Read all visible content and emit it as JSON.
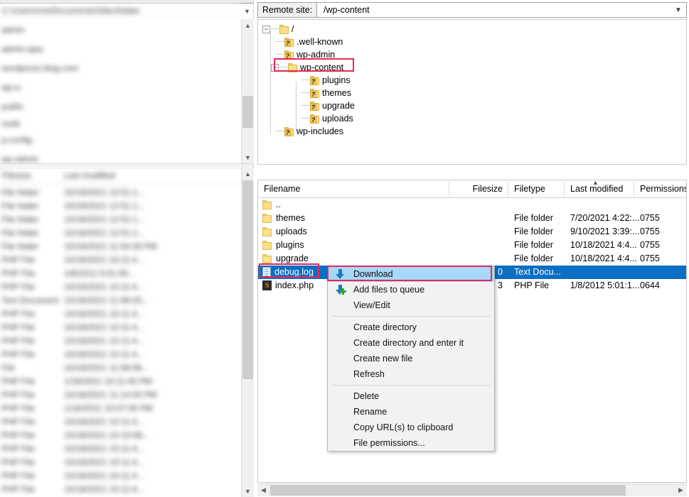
{
  "app": {
    "name": "FileZilla FTP client"
  },
  "local_pane": {
    "path_placeholder": "",
    "blurred": true,
    "tree_rows": [
      "",
      "",
      "",
      "",
      "",
      "",
      "",
      "",
      ""
    ],
    "list_headers": [
      "Filesize",
      "Last modified"
    ],
    "list_rows": [
      [
        "File folder",
        "10/18/2021 12:51:1..."
      ],
      [
        "File folder",
        "10/18/2021 12:51:1..."
      ],
      [
        "File folder",
        "10/18/2021 12:51:1..."
      ],
      [
        "File folder",
        "10/18/2021 12:51:1..."
      ],
      [
        "File folder",
        "10/18/2021 11:54:28 PM"
      ],
      [
        "PHP File",
        "10/18/2021 10:11:4..."
      ],
      [
        "PHP File",
        "1/8/2012 5:01:00..."
      ],
      [
        "PHP File",
        "10/18/2021 10:11:4..."
      ],
      [
        "Text Document",
        "10/18/2021 11:08:20..."
      ],
      [
        "PHP File",
        "10/18/2021 10:11:4..."
      ],
      [
        "PHP File",
        "10/18/2021 10:11:4..."
      ],
      [
        "PHP File",
        "10/18/2021 10:11:4..."
      ],
      [
        "PHP File",
        "10/18/2021 10:11:4..."
      ],
      [
        "File",
        "10/18/2021 11:08:08..."
      ],
      [
        "PHP File",
        "1/18/2021 10:11:40 PM"
      ],
      [
        "PHP File",
        "10/18/2021 11:14:04 PM"
      ],
      [
        "PHP File",
        "1/18/2021 10:07:00 PM"
      ],
      [
        "PHP File",
        "10/18/2021 10:11:4..."
      ],
      [
        "PHP File",
        "10/18/2021 10:10:08..."
      ],
      [
        "PHP File",
        "10/18/2021 10:11:4..."
      ],
      [
        "PHP File",
        "10/18/2021 10:11:4..."
      ],
      [
        "PHP File",
        "10/18/2021 10:11:4..."
      ],
      [
        "PHP File",
        "10/18/2021 10:11:4..."
      ]
    ]
  },
  "remote": {
    "label": "Remote site:",
    "path": "/wp-content",
    "dropdown_icon": "chevron-down-icon",
    "tree": [
      {
        "label": "/",
        "depth": 0,
        "icon": "folder-icon",
        "expander": "minus"
      },
      {
        "label": ".well-known",
        "depth": 1,
        "icon": "folder-unknown-icon",
        "expander": "none"
      },
      {
        "label": "wp-admin",
        "depth": 1,
        "icon": "folder-unknown-icon",
        "expander": "none"
      },
      {
        "label": "wp-content",
        "depth": 1,
        "icon": "folder-icon",
        "expander": "minus",
        "highlighted": true
      },
      {
        "label": "plugins",
        "depth": 2,
        "icon": "folder-unknown-icon",
        "expander": "none"
      },
      {
        "label": "themes",
        "depth": 2,
        "icon": "folder-unknown-icon",
        "expander": "none"
      },
      {
        "label": "upgrade",
        "depth": 2,
        "icon": "folder-unknown-icon",
        "expander": "none"
      },
      {
        "label": "uploads",
        "depth": 2,
        "icon": "folder-unknown-icon",
        "expander": "none"
      },
      {
        "label": "wp-includes",
        "depth": 1,
        "icon": "folder-unknown-icon",
        "expander": "none"
      }
    ],
    "columns": {
      "filename": "Filename",
      "filesize": "Filesize",
      "filetype": "Filetype",
      "last_modified": "Last modified",
      "permissions": "Permissions",
      "sorted_column": "Last modified",
      "sort_direction": "ascending"
    },
    "files": [
      {
        "name": "..",
        "icon": "folder-icon",
        "size": "",
        "type": "",
        "modified": "",
        "perms": "",
        "selected": false
      },
      {
        "name": "themes",
        "icon": "folder-icon",
        "size": "",
        "type": "File folder",
        "modified": "7/20/2021 4:22:...",
        "perms": "0755",
        "selected": false
      },
      {
        "name": "uploads",
        "icon": "folder-icon",
        "size": "",
        "type": "File folder",
        "modified": "9/10/2021 3:39:...",
        "perms": "0755",
        "selected": false
      },
      {
        "name": "plugins",
        "icon": "folder-icon",
        "size": "",
        "type": "File folder",
        "modified": "10/18/2021 4:4...",
        "perms": "0755",
        "selected": false
      },
      {
        "name": "upgrade",
        "icon": "folder-icon",
        "size": "",
        "type": "File folder",
        "modified": "10/18/2021 4:4...",
        "perms": "0755",
        "selected": false
      },
      {
        "name": "debug.log",
        "icon": "text-file-icon",
        "size": "0",
        "type": "Text Docu...",
        "modified": "",
        "perms": "",
        "selected": true
      },
      {
        "name": "index.php",
        "icon": "php-file-icon",
        "size": "3",
        "type": "PHP File",
        "modified": "1/8/2012 5:01:1...",
        "perms": "0644",
        "selected": false
      }
    ]
  },
  "context_menu": {
    "items": [
      {
        "label": "Download",
        "icon": "download-arrow-icon",
        "highlighted": true
      },
      {
        "label": "Add files to queue",
        "icon": "add-to-queue-icon",
        "highlighted": false
      },
      {
        "label": "View/Edit",
        "icon": "",
        "highlighted": false
      },
      {
        "separator": true
      },
      {
        "label": "Create directory",
        "icon": "",
        "highlighted": false
      },
      {
        "label": "Create directory and enter it",
        "icon": "",
        "highlighted": false
      },
      {
        "label": "Create new file",
        "icon": "",
        "highlighted": false
      },
      {
        "label": "Refresh",
        "icon": "",
        "highlighted": false
      },
      {
        "separator": true
      },
      {
        "label": "Delete",
        "icon": "",
        "highlighted": false
      },
      {
        "label": "Rename",
        "icon": "",
        "highlighted": false
      },
      {
        "label": "Copy URL(s) to clipboard",
        "icon": "",
        "highlighted": false
      },
      {
        "label": "File permissions...",
        "icon": "",
        "highlighted": false
      }
    ]
  },
  "annotations": {
    "color": "#e8275a",
    "boxes": [
      "wp-content-tree-node",
      "debug-log-row",
      "download-menu-item"
    ]
  },
  "colors": {
    "selection_blue": "#0b6fc4",
    "menu_highlight": "#a8d8f8",
    "annotation_red": "#e8275a",
    "folder_yellow": "#fcdf8a"
  }
}
